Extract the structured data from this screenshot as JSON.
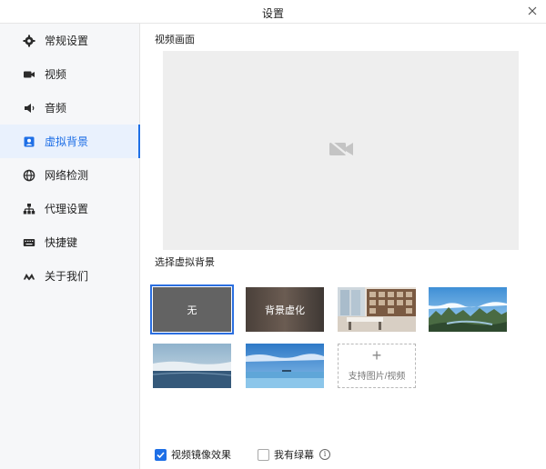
{
  "window": {
    "title": "设置"
  },
  "sidebar": {
    "items": [
      {
        "label": "常规设置",
        "icon": "gear-icon"
      },
      {
        "label": "视频",
        "icon": "video-camera-icon"
      },
      {
        "label": "音频",
        "icon": "speaker-icon"
      },
      {
        "label": "虚拟背景",
        "icon": "person-portrait-icon",
        "active": true
      },
      {
        "label": "网络检测",
        "icon": "globe-icon"
      },
      {
        "label": "代理设置",
        "icon": "network-tree-icon"
      },
      {
        "label": "快捷键",
        "icon": "keyboard-icon"
      },
      {
        "label": "关于我们",
        "icon": "logo-icon"
      }
    ]
  },
  "main": {
    "preview_label": "视频画面",
    "preview_icon": "camera-off-icon",
    "backgrounds_label": "选择虚拟背景",
    "backgrounds": [
      {
        "label": "无",
        "selected": true
      },
      {
        "label": "背景虚化"
      },
      {
        "label": ""
      },
      {
        "label": ""
      },
      {
        "label": ""
      },
      {
        "label": ""
      }
    ],
    "add_plus": "+",
    "add_label": "支持图片/视频",
    "mirror_label": "视频镜像效果",
    "mirror_checked": true,
    "greenscreen_label": "我有绿幕",
    "greenscreen_checked": false,
    "info_glyph": "i"
  },
  "colors": {
    "accent": "#1e6fe6",
    "sidebar_bg": "#f6f7f9",
    "active_bg": "#e9f1fd"
  }
}
